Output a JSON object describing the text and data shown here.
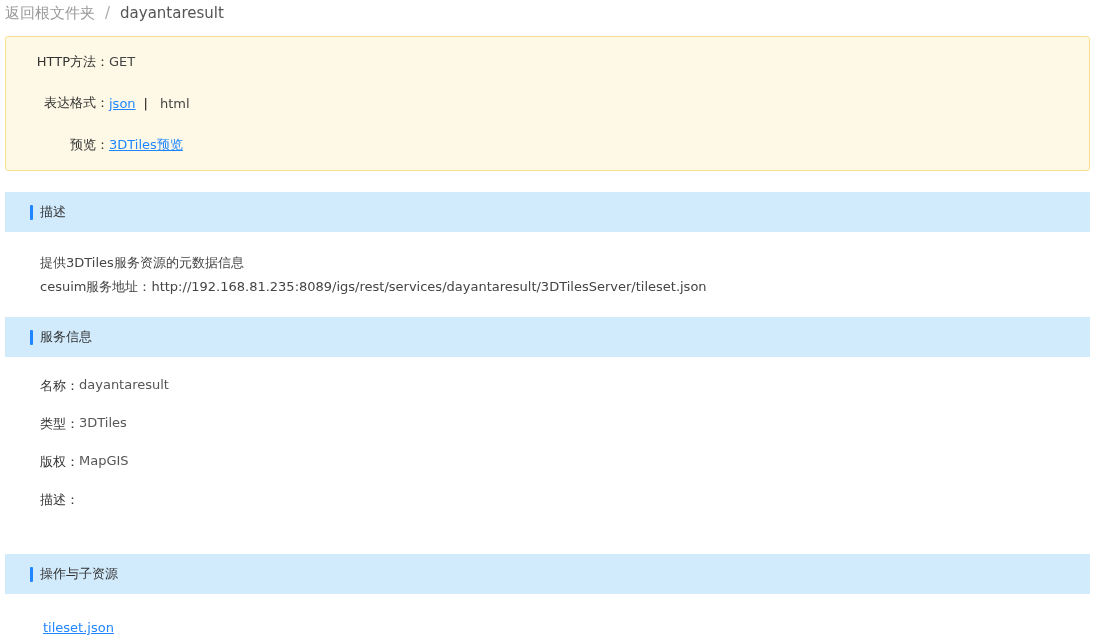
{
  "breadcrumb": {
    "root": "返回根文件夹",
    "separator": "/",
    "current": "dayantaresult"
  },
  "summary": {
    "rows": [
      {
        "label": "HTTP方法：",
        "parts": [
          {
            "kind": "text",
            "text": "GET"
          }
        ]
      },
      {
        "label": "表达格式：",
        "parts": [
          {
            "kind": "link",
            "text": "json"
          },
          {
            "kind": "separator",
            "text": "|"
          },
          {
            "kind": "text",
            "text": "html"
          }
        ]
      },
      {
        "label": "预览：",
        "parts": [
          {
            "kind": "link",
            "text": "3DTiles预览"
          }
        ]
      }
    ]
  },
  "sections": [
    {
      "title": "描述",
      "kind": "paragraphs",
      "lines": [
        "提供3DTiles服务资源的元数据信息",
        "cesuim服务地址：http://192.168.81.235:8089/igs/rest/services/dayantaresult/3DTilesServer/tileset.json"
      ]
    },
    {
      "title": "服务信息",
      "kind": "fields",
      "fields": [
        {
          "label": "名称：",
          "value": "dayantaresult"
        },
        {
          "label": "类型：",
          "value": "3DTiles"
        },
        {
          "label": "版权：",
          "value": "MapGIS"
        },
        {
          "label": "描述："
        }
      ]
    },
    {
      "title": "操作与子资源",
      "kind": "links",
      "links": [
        "tileset.json"
      ]
    }
  ]
}
